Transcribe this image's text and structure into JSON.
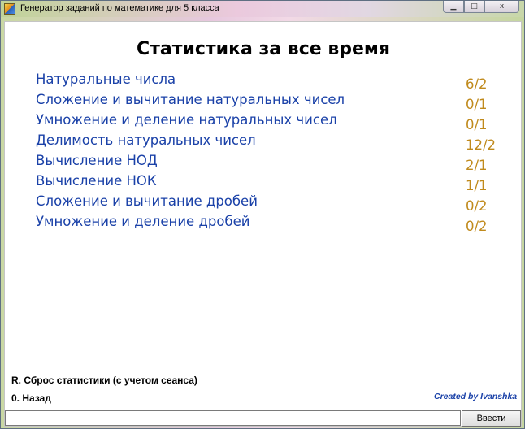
{
  "window": {
    "title": "Генератор заданий по математике для 5 класса",
    "buttons": {
      "minimize": "▁",
      "maximize": "□",
      "close": "x"
    },
    "icon": "app-icon"
  },
  "main": {
    "heading": "Статистика за все время",
    "topics": [
      {
        "label": "Натуральные числа",
        "score": "6/2"
      },
      {
        "label": "Сложение и вычитание натуральных чисел",
        "score": "0/1"
      },
      {
        "label": "Умножение и деление натуральных чисел",
        "score": "0/1"
      },
      {
        "label": "Делимость натуральных чисел",
        "score": "12/2"
      },
      {
        "label": "Вычисление НОД",
        "score": "2/1"
      },
      {
        "label": "Вычисление НОК",
        "score": "1/1"
      },
      {
        "label": "Сложение и вычитание дробей",
        "score": "0/2"
      },
      {
        "label": "Умножение и деление дробей",
        "score": "0/2"
      }
    ]
  },
  "menu": {
    "reset": "R. Сброс статистики (с учетом сеанса)",
    "back": "0. Назад"
  },
  "credit": "Created by Ivanshka",
  "input": {
    "value": "",
    "placeholder": ""
  },
  "enter_button": "Ввести",
  "colors": {
    "topic_label": "#1a41a8",
    "topic_score": "#c08a1c",
    "credit": "#1a41a8"
  }
}
